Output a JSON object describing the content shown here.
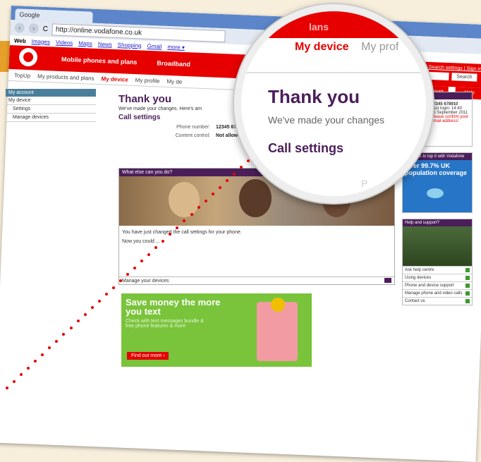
{
  "browser": {
    "tab_title": "Google",
    "url": "http://online.vodafone.co.uk",
    "reload_glyph": "C",
    "google_bar": [
      "Web",
      "Images",
      "Videos",
      "Maps",
      "News",
      "Shopping",
      "Gmail",
      "more ▾"
    ]
  },
  "vodafone": {
    "nav": [
      "Mobile phones and plans",
      "Broadband"
    ],
    "top_links": "Google | Search settings | Sign in",
    "search_label": "Search",
    "subnav": [
      "TopUp",
      "My products and plans",
      "My device",
      "My profile",
      "My de"
    ],
    "active_subnav": "My device",
    "my_account_btn": "My account",
    "help_btn": "Help"
  },
  "sidebar": {
    "header": "My account",
    "items": [
      "My device",
      "Settings",
      "Manage devices"
    ]
  },
  "main": {
    "title": "Thank you",
    "made": "We've made your changes. Here's am",
    "call_settings": "Call settings",
    "rows": [
      {
        "label": "Phone number:",
        "value": "12345 678910"
      },
      {
        "label": "Content control:",
        "value": "Not allowed"
      }
    ]
  },
  "what_else": {
    "header": "What else can you do?",
    "p1": "You have just changed the call settings for your phone.",
    "p2": "Now you could ...",
    "manage": "Manage your devices"
  },
  "promo": {
    "title": "Save money the more you text",
    "sub": "Check with text messages bundle & free phone features & more",
    "btn": "Find out more ›"
  },
  "right": {
    "account_header": "My account",
    "account_number": "12345 678910",
    "last_login": "Last login: 14:40",
    "last_login_date": "16 September 2011",
    "warn1": "Please confirm your",
    "warn2": "email address!",
    "coverage_header": "Reasons to top it with Vodafone",
    "coverage_text": "Over 99.7% UK population coverage",
    "help_header": "Help and support?",
    "help_items": [
      "Ask help centre",
      "Using devices",
      "Phone and device support",
      "Manage phone and video calls",
      "Contact us"
    ]
  },
  "magnifier": {
    "top_text": "lans",
    "tab_prev": "s",
    "tab_active": "My device",
    "tab_next": "My prof",
    "title": "Thank you",
    "made": "We've made your changes",
    "call": "Call settings",
    "ph": "P"
  }
}
